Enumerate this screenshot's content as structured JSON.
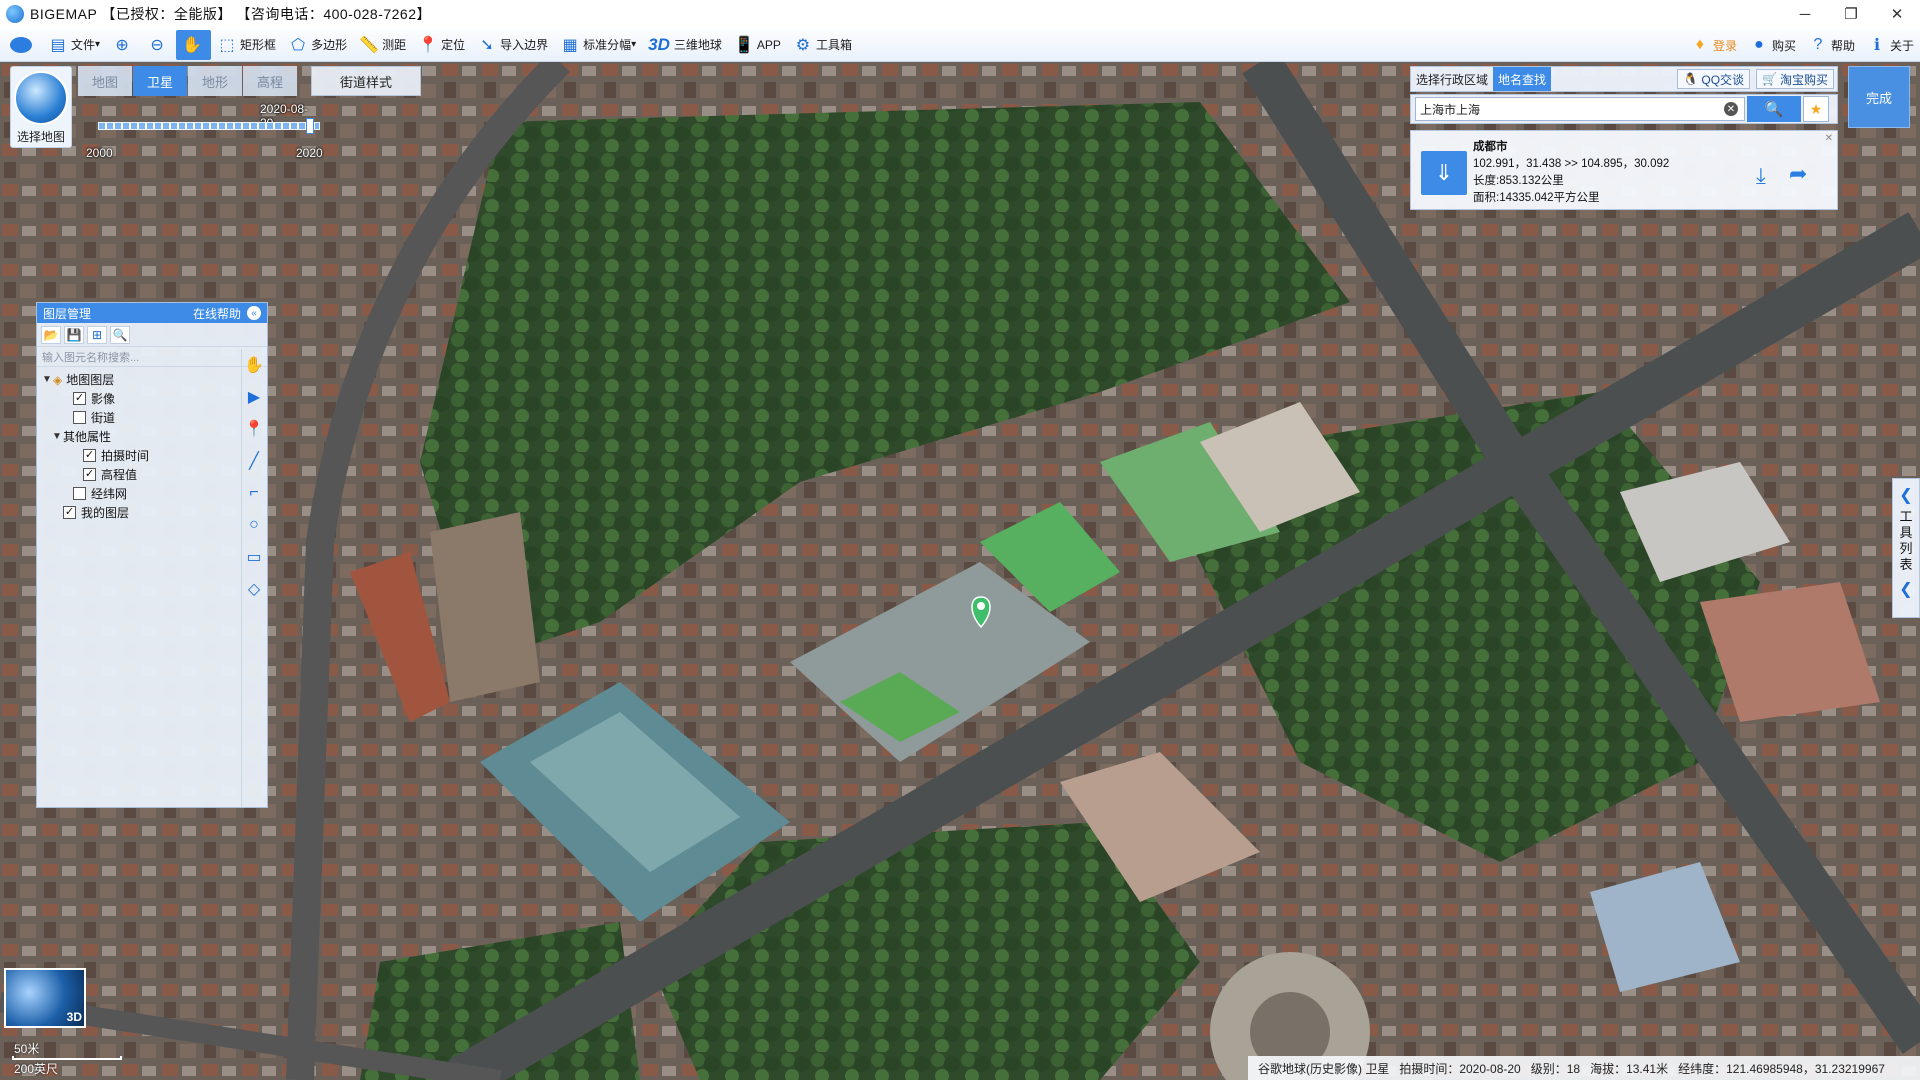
{
  "window": {
    "title": "BIGEMAP 【已授权：全能版】 【咨询电话：400-028-7262】",
    "minimize": "─",
    "maximize": "❐",
    "close": "✕"
  },
  "toolbar": {
    "items": [
      {
        "label": "文件",
        "icon": "folder-icon",
        "glyph": "▤",
        "dropdown": true
      },
      {
        "label": "",
        "icon": "zoom-in-icon",
        "glyph": "⊕"
      },
      {
        "label": "",
        "icon": "zoom-out-icon",
        "glyph": "⊖"
      },
      {
        "label": "",
        "icon": "pan-hand-icon",
        "glyph": "✋",
        "active": true
      },
      {
        "label": "矩形框",
        "icon": "rectangle-select-icon",
        "glyph": "⬚"
      },
      {
        "label": "多边形",
        "icon": "polygon-select-icon",
        "glyph": "⬠"
      },
      {
        "label": "测距",
        "icon": "ruler-icon",
        "glyph": "📏"
      },
      {
        "label": "定位",
        "icon": "location-pin-icon",
        "glyph": "📍"
      },
      {
        "label": "导入边界",
        "icon": "import-boundary-icon",
        "glyph": "➘"
      },
      {
        "label": "标准分幅",
        "icon": "grid-icon",
        "glyph": "▦",
        "dropdown": true
      },
      {
        "label": "三维地球",
        "icon": "3d-globe-icon",
        "glyph": "3D"
      },
      {
        "label": "APP",
        "icon": "phone-icon",
        "glyph": "📱"
      },
      {
        "label": "工具箱",
        "icon": "gear-icon",
        "glyph": "⚙"
      }
    ],
    "right": [
      {
        "label": "登录",
        "icon": "login-icon",
        "glyph": "♦"
      },
      {
        "label": "购买",
        "icon": "buy-icon",
        "glyph": "●"
      },
      {
        "label": "帮助",
        "icon": "help-icon",
        "glyph": "?"
      },
      {
        "label": "关于",
        "icon": "info-icon",
        "glyph": "ℹ"
      }
    ]
  },
  "map_panel": {
    "select_map_label": "选择地图",
    "tabs": [
      {
        "label": "地图",
        "active": false
      },
      {
        "label": "卫星",
        "active": true
      },
      {
        "label": "地形",
        "active": false
      },
      {
        "label": "高程",
        "active": false
      }
    ],
    "street_style": "街道样式",
    "timeline": {
      "current": "2020-08-20",
      "start": "2000",
      "end": "2020"
    }
  },
  "layer_panel": {
    "title": "图层管理",
    "help": "在线帮助",
    "collapse": "«",
    "tools": [
      "📂",
      "💾",
      "⊞",
      "🔍"
    ],
    "search_placeholder": "输入图元名称搜索...",
    "tree": [
      {
        "label": "地图图层",
        "level": 0,
        "toggle": "▼",
        "checkbox": null,
        "icon": "layers-icon"
      },
      {
        "label": "影像",
        "level": 2,
        "toggle": "",
        "checkbox": true
      },
      {
        "label": "街道",
        "level": 2,
        "toggle": "",
        "checkbox": false
      },
      {
        "label": "其他属性",
        "level": 1,
        "toggle": "▼",
        "checkbox": null
      },
      {
        "label": "拍摄时间",
        "level": 3,
        "toggle": "",
        "checkbox": true
      },
      {
        "label": "高程值",
        "level": 3,
        "toggle": "",
        "checkbox": true
      },
      {
        "label": "经纬网",
        "level": 2,
        "toggle": "",
        "checkbox": false
      },
      {
        "label": "我的图层",
        "level": 1,
        "toggle": "",
        "checkbox": true
      }
    ],
    "side_tools": [
      {
        "icon": "hand-tool-icon",
        "glyph": "✋"
      },
      {
        "icon": "pointer-icon",
        "glyph": "▶"
      },
      {
        "icon": "marker-icon",
        "glyph": "📍"
      },
      {
        "icon": "line-tool-icon",
        "glyph": "╱"
      },
      {
        "icon": "polyline-tool-icon",
        "glyph": "⌐"
      },
      {
        "icon": "circle-tool-icon",
        "glyph": "○"
      },
      {
        "icon": "rectangle-tool-icon",
        "glyph": "▭"
      },
      {
        "icon": "eraser-icon",
        "glyph": "◇"
      }
    ]
  },
  "search_panel": {
    "tabs": [
      {
        "label": "选择行政区域",
        "active": false
      },
      {
        "label": "地名查找",
        "active": true
      }
    ],
    "qq_button": "QQ交谈",
    "taobao_button": "淘宝购买",
    "query": "上海市上海",
    "clear": "✕",
    "go": "🔍",
    "fav": "★",
    "result": {
      "name": "成都市",
      "coords": "102.991，31.438 >> 104.895，30.092",
      "length": "长度:853.132公里",
      "area": "面积:14335.042平方公里"
    }
  },
  "done_button": "完成",
  "tool_tab": {
    "arrow_up": "❮",
    "label": "工具列表",
    "arrow_down": "❮"
  },
  "minimap_label": "3D",
  "scale": {
    "metric": "50米",
    "imperial": "200英尺"
  },
  "status": {
    "source": "谷歌地球(历史影像) 卫星",
    "date": "拍摄时间：2020-08-20",
    "level": "级别：18",
    "altitude": "海拔：13.41米",
    "coords": "经纬度：121.46985948，31.23219967"
  },
  "colors": {
    "accent": "#3d8be6",
    "pin": "#3fbf6a"
  }
}
